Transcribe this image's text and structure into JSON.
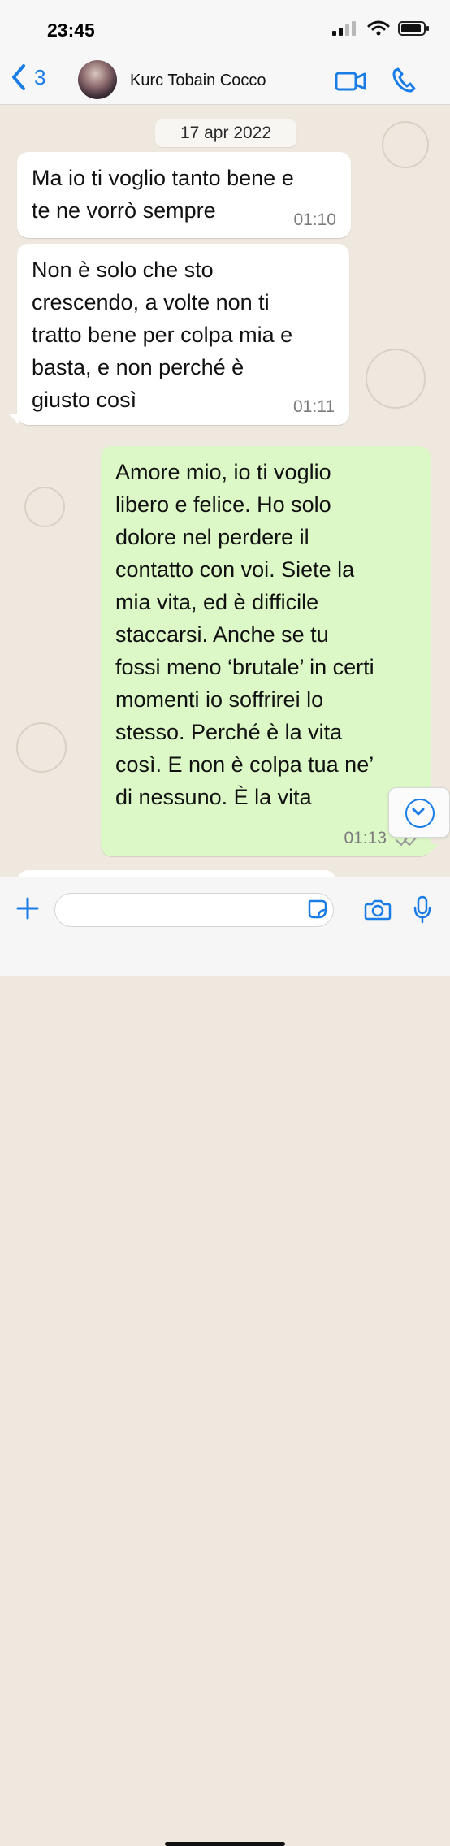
{
  "status_bar": {
    "time": "23:45"
  },
  "header": {
    "back_count": "3",
    "contact_name": "Kurc Tobain Cocco"
  },
  "chat": {
    "date": "17 apr 2022",
    "messages": [
      {
        "text": "Ma io ti voglio tanto bene e\nte ne vorrò sempre",
        "time": "01:10"
      },
      {
        "text": "Non è solo che sto\ncrescendo, a volte non ti\ntratto bene per colpa mia e\nbasta, e non perché è\ngiusto così",
        "time": "01:11"
      },
      {
        "text": "Amore mio, io ti voglio\nlibero e felice. Ho solo\ndolore nel perdere il\ncontatto con voi. Siete la\nmia vita, ed è difficile\nstaccarsi. Anche se tu\nfossi meno ‘brutale’ in certi\nmomenti io soffrirei lo\nstesso. Perché è la vita\ncosì. E non è colpa tua ne’\ndi nessuno. È la vita",
        "time": "01:13"
      }
    ]
  },
  "composer": {
    "placeholder": ""
  },
  "colors": {
    "accent": "#1a7ce6",
    "incoming_bubble": "#ffffff",
    "outgoing_bubble": "#dcf8c6",
    "chat_background": "#efe8df"
  },
  "icons": {
    "back": "chevron-left-icon",
    "video": "video-camera-icon",
    "call": "phone-icon",
    "plus": "plus-icon",
    "sticker": "sticker-icon",
    "camera": "camera-icon",
    "mic": "microphone-icon",
    "scroll": "chevron-down-icon",
    "read": "double-check-icon"
  }
}
